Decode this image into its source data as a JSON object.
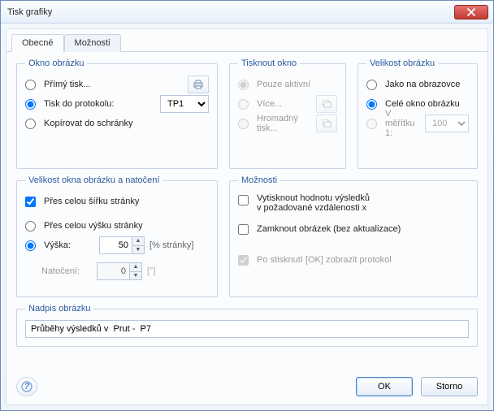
{
  "window": {
    "title": "Tisk grafiky"
  },
  "tabs": {
    "general": "Obecné",
    "options": "Možnosti"
  },
  "okno_obrazku": {
    "legend": "Okno obrázku",
    "primy_tisk": "Přímý tisk...",
    "tisk_do_protokolu": "Tisk do protokolu:",
    "kopirovat": "Kopírovat do schránky",
    "protokol_value": "TP1"
  },
  "tisknout_okno": {
    "legend": "Tisknout okno",
    "pouze_aktivni": "Pouze aktivní",
    "vice": "Více...",
    "hromadny": "Hromadný tisk..."
  },
  "velikost_obrazku": {
    "legend": "Velikost obrázku",
    "jako_na_obrazovce": "Jako na obrazovce",
    "cele_okno": "Celé okno obrázku",
    "v_meritku": "V měřítku 1:",
    "scale_value": "100"
  },
  "velikost_okna": {
    "legend": "Velikost okna obrázku a natočení",
    "cela_sirka": "Přes celou šířku stránky",
    "cela_vyska": "Přes celou výšku stránky",
    "vyska_label": "Výška:",
    "vyska_value": "50",
    "vyska_unit": "[% stránky]",
    "natoceni_label": "Natočení:",
    "natoceni_value": "0",
    "natoceni_unit": "[°]"
  },
  "moznosti": {
    "legend": "Možnosti",
    "vytisknout_hodnotu": "Vytisknout hodnotu výsledků",
    "vytisknout_hodnotu_sub": "v požadované vzdálenosti x",
    "zamknout": "Zamknout obrázek (bez aktualizace)",
    "po_stisknuti": "Po stisknutí [OK] zobrazit protokol"
  },
  "nadpis": {
    "legend": "Nadpis obrázku",
    "value": "Průběhy výsledků v  Prut -  P7"
  },
  "buttons": {
    "ok": "OK",
    "cancel": "Storno"
  }
}
